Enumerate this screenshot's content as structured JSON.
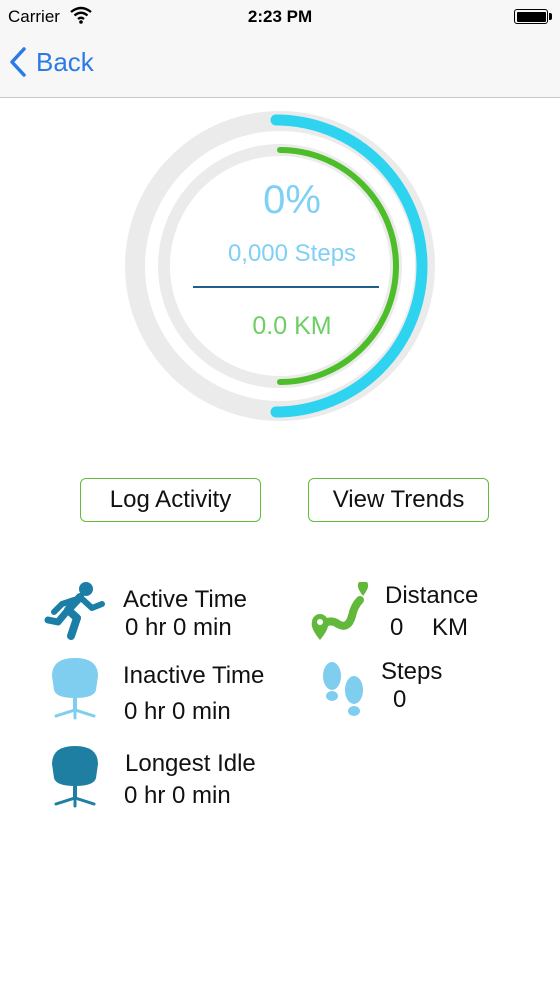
{
  "status_bar": {
    "carrier": "Carrier",
    "time": "2:23 PM"
  },
  "nav": {
    "back_label": "Back"
  },
  "progress": {
    "percent_text": "0%",
    "steps_text": "0,000  Steps",
    "distance_text": "0.0 KM",
    "colors": {
      "outer_arc": "#2ed3f0",
      "inner_arc": "#4dbd2a",
      "track": "#ebebeb"
    }
  },
  "buttons": {
    "log_activity": "Log Activity",
    "view_trends": "View Trends"
  },
  "stats": {
    "active_time": {
      "label": "Active Time",
      "value": "0 hr 0 min"
    },
    "inactive_time": {
      "label": "Inactive Time",
      "value": "0 hr 0 min"
    },
    "longest_idle": {
      "label": "Longest Idle",
      "value": "0 hr 0 min"
    },
    "distance": {
      "label": "Distance",
      "value": "0",
      "unit": "KM"
    },
    "steps": {
      "label": "Steps",
      "value": "0"
    }
  },
  "icons": {
    "active_time": "running-man-icon",
    "inactive_time": "chair-light-icon",
    "longest_idle": "chair-dark-icon",
    "distance": "route-pin-icon",
    "steps": "footprints-icon"
  }
}
